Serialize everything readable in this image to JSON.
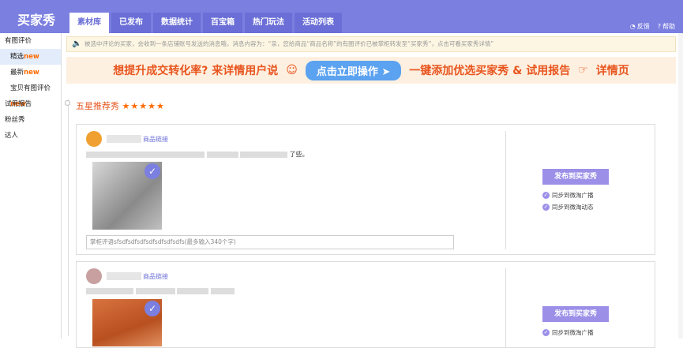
{
  "brand": "买家秀",
  "tabs": [
    {
      "label": "素材库",
      "active": true
    },
    {
      "label": "已发布"
    },
    {
      "label": "数据统计"
    },
    {
      "label": "百宝箱"
    },
    {
      "label": "热门玩法"
    },
    {
      "label": "活动列表"
    }
  ],
  "top_links": {
    "feedback": "反馈",
    "help": "帮助"
  },
  "sidebar": {
    "items": [
      {
        "label": "有图评价"
      },
      {
        "label": "精选",
        "badge": "new"
      },
      {
        "label": "最新",
        "badge": "new"
      },
      {
        "label": "宝贝有图评价",
        "badge": "new"
      },
      {
        "label": "试用报告"
      },
      {
        "label": "粉丝秀"
      },
      {
        "label": "达人"
      }
    ]
  },
  "notice": "被选中评论的买家，会收到一条店铺账号发送的消息哦，消息内容为：“亲，您给商品“商品名称”的有图评价已被掌柜转发至“买家秀”，点击可看买家秀详情”",
  "promo": {
    "left": "想提升成交转化率? 来详情用户说",
    "button": "点击立即操作",
    "right": "一键添加优选买家秀 & 试用报告",
    "tail": "详情页"
  },
  "section": {
    "title": "五星推荐秀",
    "stars": "★★★★★"
  },
  "cards": [
    {
      "link": "商品链接",
      "review_tail": "了些。",
      "reply_placeholder": "掌柜评语sfsdfsdfsdfsdfsdfsdfsdfs(最多输入340个字)",
      "publish": "发布到买家秀",
      "opts": [
        "同步到微淘广播",
        "同步到微淘动态"
      ]
    },
    {
      "link": "商品链接",
      "publish": "发布到买家秀",
      "opts": [
        "同步到微淘广播"
      ]
    }
  ]
}
